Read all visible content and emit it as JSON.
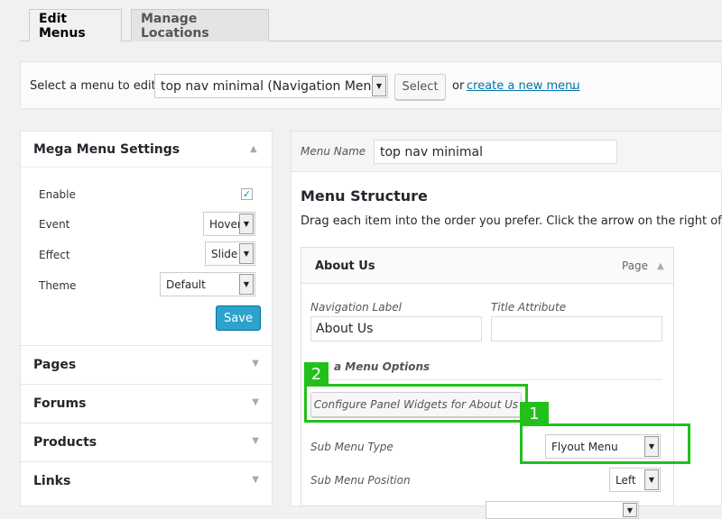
{
  "tabs": {
    "edit": "Edit Menus",
    "manage": "Manage Locations"
  },
  "select_bar": {
    "label": "Select a menu to edit:",
    "selected_menu": "top nav minimal (Navigation Menu)",
    "select_button": "Select",
    "or_text": "or",
    "create_link": "create a new menu",
    "period": "."
  },
  "mega_menu": {
    "title": "Mega Menu Settings",
    "enable_label": "Enable",
    "enabled_mark": "✓",
    "event_label": "Event",
    "event_value": "Hover",
    "effect_label": "Effect",
    "effect_value": "Slide",
    "theme_label": "Theme",
    "theme_value": "Default",
    "save_button": "Save"
  },
  "accordion": [
    "Pages",
    "Forums",
    "Products",
    "Links"
  ],
  "menu": {
    "name_label": "Menu Name",
    "name_value": "top nav minimal",
    "structure_title": "Menu Structure",
    "structure_desc": "Drag each item into the order you prefer. Click the arrow on the right of the it"
  },
  "item": {
    "title": "About Us",
    "type": "Page",
    "nav_label_label": "Navigation Label",
    "nav_label_value": "About Us",
    "title_attr_label": "Title Attribute",
    "title_attr_value": "",
    "mmo_title": "a Menu Options",
    "configure_button": "Configure Panel Widgets for About Us",
    "sub_menu_type_label": "Sub Menu Type",
    "sub_menu_type_value": "Flyout Menu",
    "sub_menu_position_label": "Sub Menu Position",
    "sub_menu_position_value": "Left"
  },
  "annotations": {
    "one": "1",
    "two": "2"
  },
  "colors": {
    "accent": "#2ea2cc",
    "annotation": "#22c01a",
    "link": "#0073aa"
  }
}
